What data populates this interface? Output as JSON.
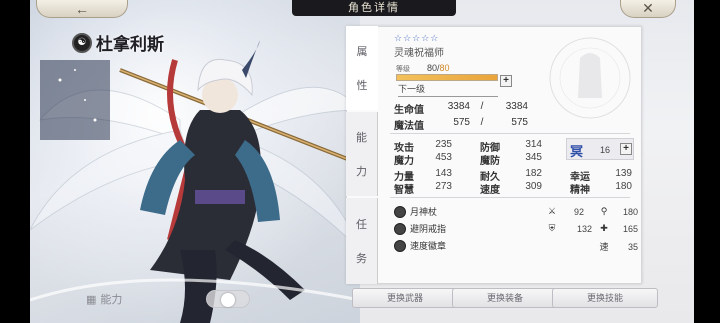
{
  "header": {
    "title": "角色详情",
    "back_icon": "←",
    "close_icon": "✕"
  },
  "character": {
    "name": "杜拿利斯",
    "rarity_stars": "☆☆☆☆☆",
    "class_name": "灵魂祝福师"
  },
  "side_tabs": {
    "attr": [
      "属",
      "性"
    ],
    "ability": [
      "能",
      "力"
    ],
    "task": [
      "任",
      "务"
    ]
  },
  "level": {
    "label": "等级",
    "current": "80",
    "separator": "/",
    "max": "80",
    "progress": 1.0,
    "next_label": "下一级"
  },
  "vitals": [
    {
      "label": "生命值",
      "current": "3384",
      "sep": "/",
      "max": "3384"
    },
    {
      "label": "魔法值",
      "current": "575",
      "sep": "/",
      "max": "575"
    }
  ],
  "stats": {
    "atk": {
      "label": "攻击",
      "value": "235"
    },
    "def": {
      "label": "防御",
      "value": "314"
    },
    "matk": {
      "label": "魔力",
      "value": "453"
    },
    "mdef": {
      "label": "魔防",
      "value": "345"
    },
    "str": {
      "label": "力量",
      "value": "143"
    },
    "dur": {
      "label": "耐久",
      "value": "182"
    },
    "luk": {
      "label": "幸运",
      "value": "139"
    },
    "int": {
      "label": "智慧",
      "value": "273"
    },
    "spd": {
      "label": "速度",
      "value": "309"
    },
    "spi": {
      "label": "精神",
      "value": "180"
    }
  },
  "points": {
    "glyph": "冥",
    "value": "16"
  },
  "equipment": [
    {
      "name": "月神杖"
    },
    {
      "name": "避阴戒指"
    },
    {
      "name": "速度徽章"
    }
  ],
  "equip_stats": [
    {
      "icon": "sword-icon",
      "glyph": "⚔",
      "value": "92"
    },
    {
      "icon": "magic-icon",
      "glyph": "⚲",
      "value": "180"
    },
    {
      "icon": "shield-icon",
      "glyph": "⛨",
      "value": "132"
    },
    {
      "icon": "plus-shield-icon",
      "glyph": "✚",
      "value": "165"
    },
    {
      "icon": "speed-label",
      "glyph": "速",
      "value": "35"
    }
  ],
  "bottom_buttons": {
    "weapon": "更换武器",
    "gear": "更换装备",
    "skill": "更换技能"
  },
  "bottom_left": {
    "label": "能力"
  }
}
